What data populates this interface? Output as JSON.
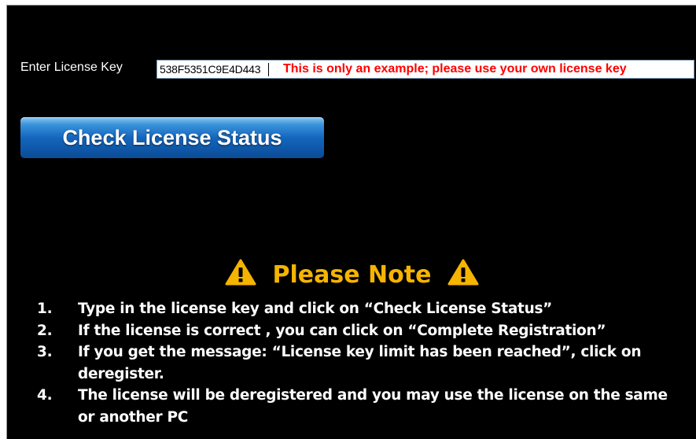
{
  "license": {
    "label": "Enter License Key",
    "value": "538F5351C9E4D443",
    "example_note": "This is only an example; please use your own license key"
  },
  "check_button": {
    "label": "Check License Status"
  },
  "note": {
    "title": "Please Note",
    "icon": "warning-triangle-icon",
    "steps": [
      {
        "number": "1.",
        "text": "Type in the license key and click on “Check License Status”"
      },
      {
        "number": "2.",
        "text": "If the license is correct , you can click on “Complete  Registration”"
      },
      {
        "number": "3.",
        "text": "If you get the message: “License key limit has been reached”, click  on deregister."
      },
      {
        "number": "4.",
        "text": "The license will be deregistered and you may use the license  on the same or another PC"
      }
    ]
  },
  "colors": {
    "background": "#000000",
    "note_heading": "#f5b400",
    "example_note": "#ff0000",
    "button": "#1466bd"
  }
}
